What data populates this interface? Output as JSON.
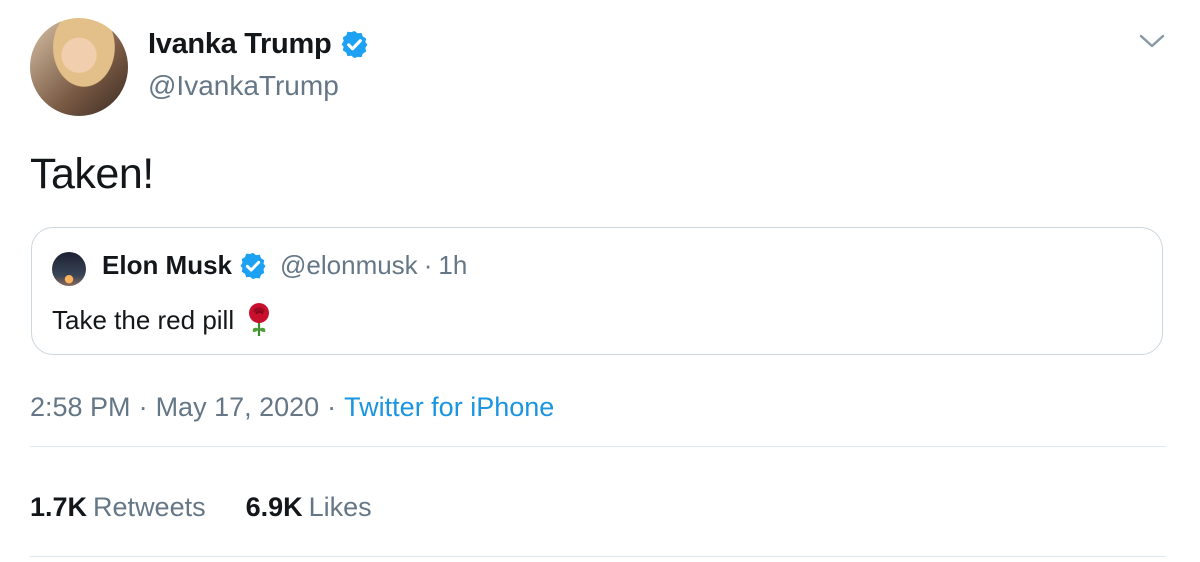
{
  "author": {
    "name": "Ivanka Trump",
    "handle": "@IvankaTrump"
  },
  "tweet": {
    "text": "Taken!"
  },
  "quoted": {
    "name": "Elon Musk",
    "handle": "@elonmusk",
    "age": "1h",
    "text": "Take the red pill",
    "emoji": "rose-emoji"
  },
  "meta": {
    "time": "2:58 PM",
    "date": "May 17, 2020",
    "source": "Twitter for iPhone"
  },
  "stats": {
    "retweets_count": "1.7K",
    "retweets_label": "Retweets",
    "likes_count": "6.9K",
    "likes_label": "Likes"
  },
  "colors": {
    "verified_blue": "#1da1f2",
    "link_blue": "#1b95e0",
    "muted": "#657786"
  }
}
